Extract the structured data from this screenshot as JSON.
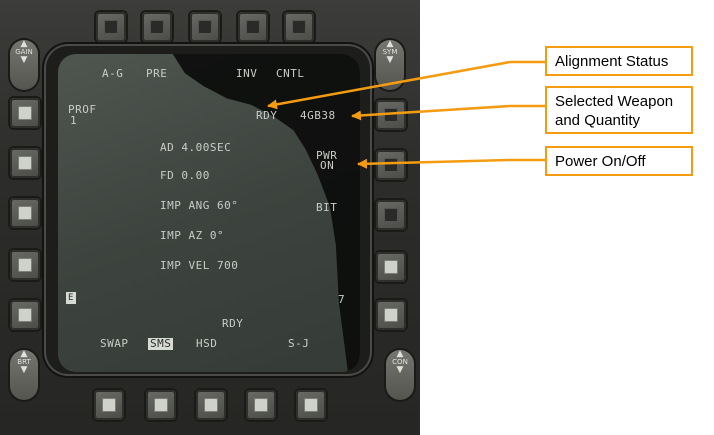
{
  "screen": {
    "top_row": {
      "a_g": "A-G",
      "pre": "PRE",
      "inv": "INV",
      "cntl": "CNTL"
    },
    "prof": {
      "label": "PROF",
      "number": "1"
    },
    "alignment_status": "RDY",
    "weapon_quantity": "4GB38",
    "pwr": {
      "line1": "PWR",
      "line2": "ON"
    },
    "bit": "BIT",
    "params": {
      "ad": "AD 4.00SEC",
      "fd": "FD 0.00",
      "imp_ang": "IMP ANG 60°",
      "imp_az": "IMP AZ 0°",
      "imp_vel": "IMP VEL 700"
    },
    "left_marker": "E",
    "right_marker": "7",
    "bottom_rdy": "RDY",
    "bottom_row": {
      "swap": "SWAP",
      "sms": "SMS",
      "hsd": "HSD",
      "sj": "S-J"
    }
  },
  "rockers": {
    "gain": "GAIN",
    "sym": "SYM",
    "brt": "BRT",
    "con": "CON"
  },
  "callouts": {
    "alignment_status": "Alignment Status",
    "selected_weapon_line1": "Selected Weapon",
    "selected_weapon_line2": "and Quantity",
    "power": "Power On/Off"
  },
  "colors": {
    "callout_border": "#f39c12",
    "callout_arrow": "#f39c12",
    "screen_text": "#c9ccc6"
  }
}
